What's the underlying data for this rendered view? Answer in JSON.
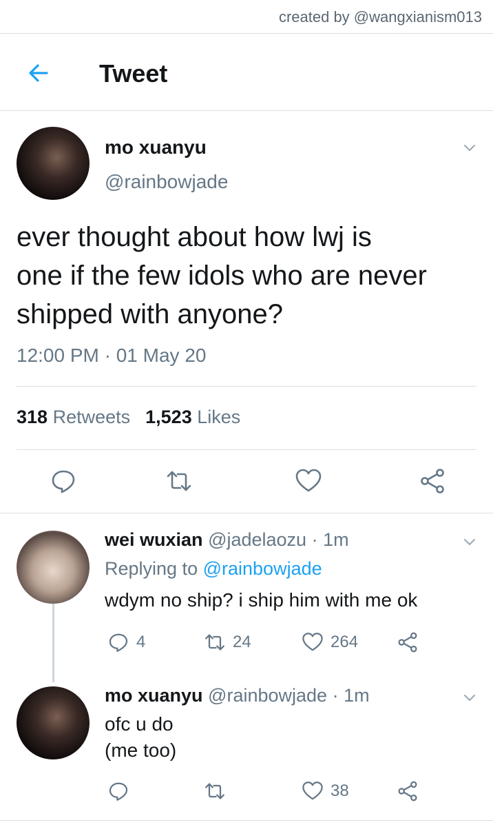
{
  "credit": "created by @wangxianism013",
  "header": {
    "title": "Tweet"
  },
  "main_tweet": {
    "name": "mo xuanyu",
    "handle": "@rainbowjade",
    "text_lines": [
      "ever thought about how lwj is",
      "one if the few idols who are never",
      "shipped with anyone?"
    ],
    "timestamp": "12:00 PM · 01 May 20",
    "retweets": "318",
    "retweets_label": "Retweets",
    "likes": "1,523",
    "likes_label": "Likes"
  },
  "replies": [
    {
      "name": "wei wuxian",
      "handle": "@jadelaozu",
      "time": "· 1m",
      "replying_prefix": "Replying to",
      "replying_to": "@rainbowjade",
      "text_lines": [
        "wdym no ship? i ship him with me ok"
      ],
      "reply_count": "4",
      "retweet_count": "24",
      "like_count": "264"
    },
    {
      "name": "mo xuanyu",
      "handle": "@rainbowjade",
      "time": "· 1m",
      "text_lines": [
        "ofc u do",
        "(me too)"
      ],
      "like_count": "38"
    }
  ],
  "colors": {
    "accent": "#1da1f2",
    "muted": "#657786",
    "text": "#14171a",
    "divider": "#d9dfe4"
  },
  "icons": [
    "back-arrow-icon",
    "chevron-down-icon",
    "reply-icon",
    "retweet-icon",
    "like-icon",
    "share-icon"
  ]
}
